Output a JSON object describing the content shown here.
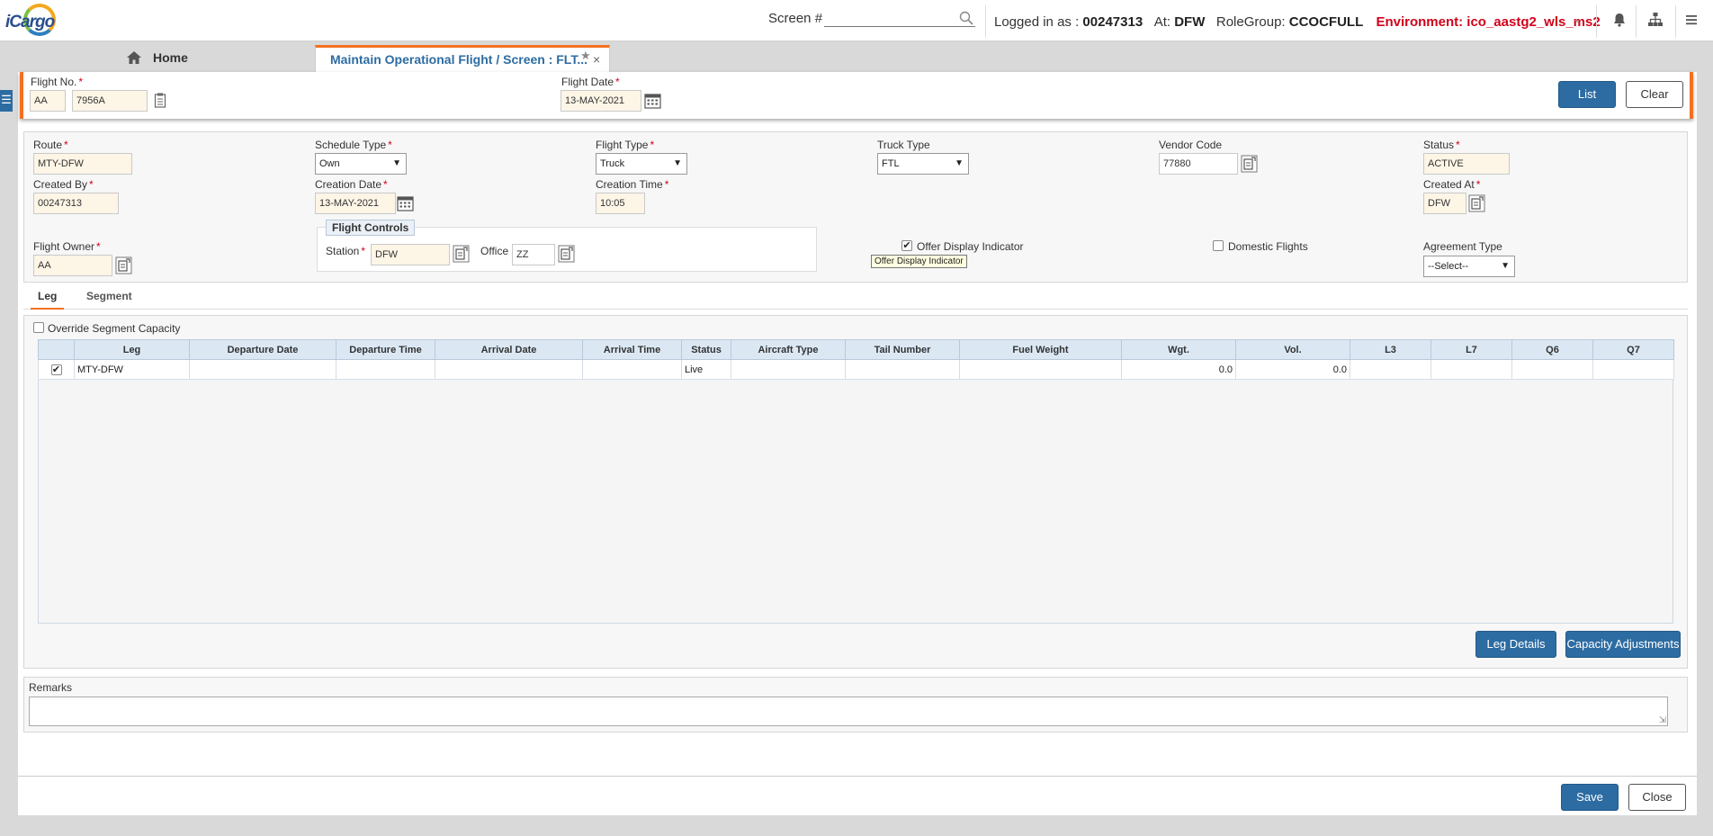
{
  "header": {
    "logo_text": "iCargo",
    "screen_label": "Screen #",
    "logged_in_label": "Logged in as :",
    "user_id": "00247313",
    "at_label": "At:",
    "station": "DFW",
    "role_group_label": "RoleGroup:",
    "role_group": "CCOCFULL",
    "environment": "Environment: ico_aastg2_wls_ms2"
  },
  "tabs": {
    "home": "Home",
    "active": "Maintain Operational Flight / Screen : FLT..."
  },
  "filter": {
    "flight_no_label": "Flight No.",
    "carrier": "AA",
    "flight_number": "7956A",
    "flight_date_label": "Flight Date",
    "flight_date": "13-MAY-2021",
    "list_btn": "List",
    "clear_btn": "Clear"
  },
  "details": {
    "route_label": "Route",
    "route": "MTY-DFW",
    "schedule_type_label": "Schedule Type",
    "schedule_type": "Own",
    "flight_type_label": "Flight Type",
    "flight_type": "Truck",
    "truck_type_label": "Truck Type",
    "truck_type": "FTL",
    "vendor_code_label": "Vendor Code",
    "vendor_code": "77880",
    "status_label": "Status",
    "status": "ACTIVE",
    "created_by_label": "Created By",
    "created_by": "00247313",
    "creation_date_label": "Creation Date",
    "creation_date": "13-MAY-2021",
    "creation_time_label": "Creation Time",
    "creation_time": "10:05",
    "created_at_label": "Created At",
    "created_at": "DFW",
    "flight_owner_label": "Flight Owner",
    "flight_owner": "AA",
    "flight_controls_label": "Flight Controls",
    "station_label": "Station",
    "station": "DFW",
    "office_label": "Office",
    "office": "ZZ",
    "offer_display_label": "Offer Display Indicator",
    "offer_display_checked": true,
    "offer_display_tooltip": "Offer Display Indicator",
    "domestic_label": "Domestic Flights",
    "domestic_checked": false,
    "agreement_type_label": "Agreement Type",
    "agreement_type": "--Select--"
  },
  "subtabs": {
    "leg": "Leg",
    "segment": "Segment"
  },
  "grid": {
    "override_label": "Override Segment Capacity",
    "columns": [
      "",
      "Leg",
      "Departure Date",
      "Departure Time",
      "Arrival Date",
      "Arrival Time",
      "Status",
      "Aircraft Type",
      "Tail Number",
      "Fuel Weight",
      "Wgt.",
      "Vol.",
      "L3",
      "L7",
      "Q6",
      "Q7"
    ],
    "rows": [
      {
        "checked": true,
        "leg": "MTY-DFW",
        "dep_date": "",
        "dep_time": "",
        "arr_date": "",
        "arr_time": "",
        "status": "Live",
        "aircraft": "",
        "tail": "",
        "fuel": "",
        "wgt": "0.0",
        "vol": "0.0",
        "l3": "",
        "l7": "",
        "q6": "",
        "q7": ""
      }
    ],
    "leg_details_btn": "Leg Details",
    "capacity_btn": "Capacity Adjustments"
  },
  "remarks": {
    "label": "Remarks",
    "value": ""
  },
  "footer": {
    "save_btn": "Save",
    "close_btn": "Close"
  },
  "colors": {
    "accent": "#f37021",
    "primary": "#2d6ca2",
    "environment": "#d0021b"
  }
}
